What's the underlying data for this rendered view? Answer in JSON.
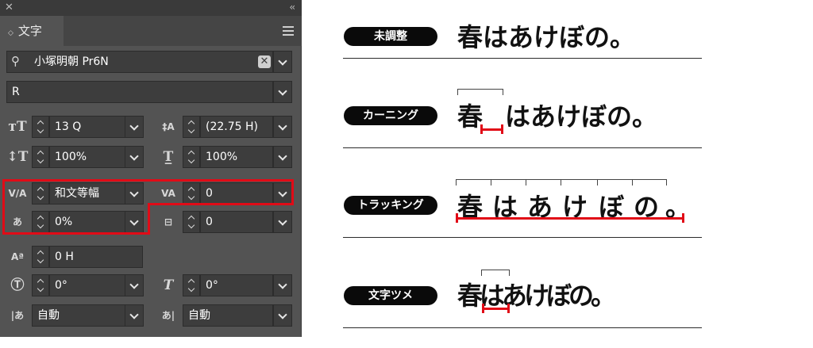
{
  "panel": {
    "tab_label": "文字",
    "font_family": "小塚明朝 Pr6N",
    "font_style": "R",
    "font_size": "13 Q",
    "leading": "(22.75 H)",
    "vertical_scale": "100%",
    "horizontal_scale": "100%",
    "kerning": "和文等幅",
    "tracking": "0",
    "tsume": "0%",
    "aki": "0",
    "baseline_shift": "0 H",
    "rotation": "0°",
    "skew": "0°",
    "aki_left": "自動",
    "aki_right": "自動"
  },
  "examples": [
    {
      "label": "未調整",
      "text": "春はあけぼの。"
    },
    {
      "label": "カーニング",
      "text": "春はあけぼの。"
    },
    {
      "label": "トラッキング",
      "text": "春はあけぼの。"
    },
    {
      "label": "文字ツメ",
      "text": "春はあけぼの。"
    }
  ],
  "glyphs": [
    "春",
    "は",
    "あ",
    "け",
    "ぼ",
    "の",
    "。"
  ],
  "accent_color": "#e10b17",
  "panel_bg": "#535353",
  "field_bg": "#3d3d3d"
}
